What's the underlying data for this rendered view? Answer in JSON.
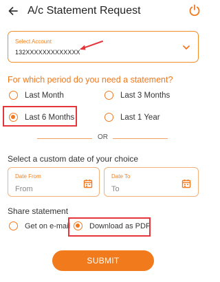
{
  "header": {
    "title": "A/c Statement Request",
    "back_icon": "arrow-left-icon",
    "power_icon": "power-icon"
  },
  "account": {
    "label": "Select Account",
    "value": "132XXXXXXXXXXXXX"
  },
  "period": {
    "question": "For which period do you need a statement?",
    "options": [
      {
        "label": "Last Month",
        "checked": false
      },
      {
        "label": "Last 3 Months",
        "checked": false
      },
      {
        "label": "Last 6 Months",
        "checked": true
      },
      {
        "label": "Last 1 Year",
        "checked": false
      }
    ]
  },
  "divider": {
    "text": "OR"
  },
  "custom": {
    "question": "Select a custom date of your choice",
    "from": {
      "label": "Date From",
      "placeholder": "From"
    },
    "to": {
      "label": "Date To",
      "placeholder": "To"
    }
  },
  "share": {
    "question": "Share statement",
    "options": [
      {
        "label": "Get on e-mail",
        "checked": false
      },
      {
        "label": "Download as PDF",
        "checked": true
      }
    ]
  },
  "submit": {
    "label": "SUBMIT"
  },
  "colors": {
    "accent": "#f0781e",
    "highlight": "#e5343a",
    "text": "#333333"
  }
}
